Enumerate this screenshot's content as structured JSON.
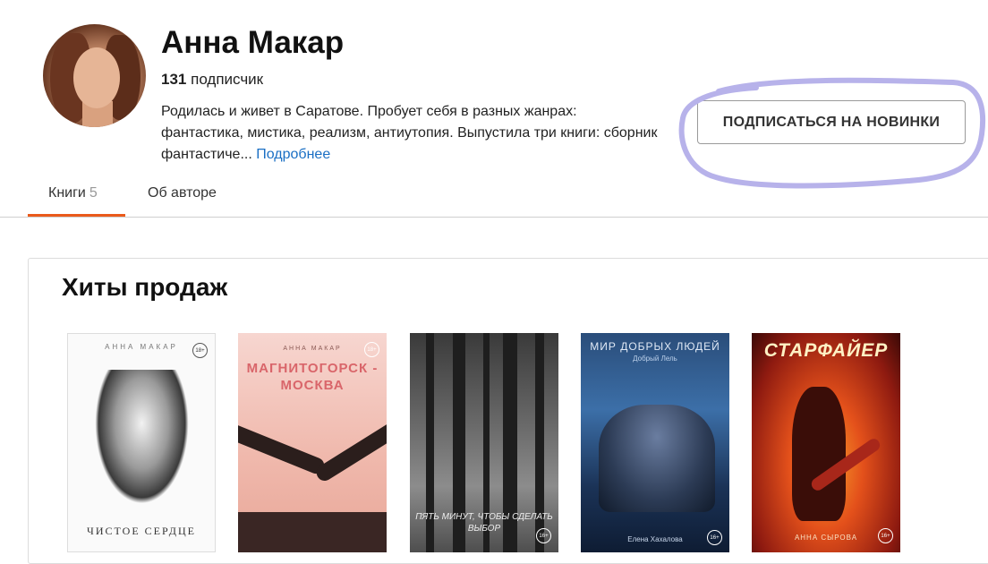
{
  "author": {
    "name": "Анна Макар",
    "subscribers_count": "131",
    "subscribers_label": "подписчик",
    "bio": "Родилась и живет в Саратове. Пробует себя в разных жанрах: фантастика, мистика, реализм, антиутопия. Выпустила три книги: сборник фантастиче...",
    "more_link": "Подробнее"
  },
  "subscribe_button": "ПОДПИСАТЬСЯ НА НОВИНКИ",
  "tabs": [
    {
      "label": "Книги",
      "count": "5",
      "active": true
    },
    {
      "label": "Об авторе",
      "active": false
    }
  ],
  "section": {
    "title": "Хиты продаж",
    "books": [
      {
        "cover_author": "АННА МАКАР",
        "cover_title": "ЧИСТОЕ СЕРДЦЕ",
        "badge": "18+"
      },
      {
        "cover_author": "АННА МАКАР",
        "cover_title": "МАГНИТОГОРСК - МОСКВА",
        "badge": "18+"
      },
      {
        "cover_title": "ПЯТЬ МИНУТ, ЧТОБЫ СДЕЛАТЬ ВЫБОР",
        "badge": "16+"
      },
      {
        "cover_title": "МИР ДОБРЫХ ЛЮДЕЙ",
        "cover_subtitle": "Добрый Лель",
        "cover_author": "Елена Хахалова",
        "badge": "16+"
      },
      {
        "cover_title": "СТАРФАЙЕР",
        "cover_author": "АННА СЫРОВА",
        "badge": "16+"
      }
    ]
  },
  "colors": {
    "tab_active_underline": "#ea5a1b",
    "link": "#1a6fc4",
    "scribble": "#b7b2ea"
  }
}
